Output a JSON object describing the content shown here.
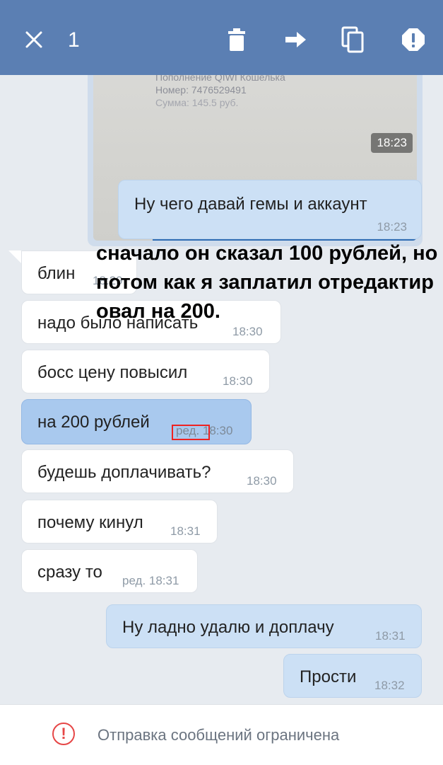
{
  "header": {
    "selected_count": "1",
    "icons": [
      "close-icon",
      "delete-icon",
      "forward-icon",
      "copy-icon",
      "report-icon"
    ],
    "bg_color": "#5b7fb3"
  },
  "photo": {
    "receipt_lines": [
      "Пополнение QIWI Кошелька",
      "Номер: 7476529491",
      "Сумма: 145.5 руб."
    ],
    "time": "18:23"
  },
  "messages": [
    {
      "dir": "out",
      "text": "Ну чего давай гемы и аккаунт",
      "time": "18:23"
    },
    {
      "dir": "in",
      "text": "блин",
      "time": "18:29"
    },
    {
      "dir": "in",
      "text": "надо было написать",
      "time": "18:30"
    },
    {
      "dir": "in",
      "text": "босс цену повысил",
      "time": "18:30"
    },
    {
      "dir": "in",
      "text": "на 200 рублей",
      "time": "ред. 18:30",
      "selected": true
    },
    {
      "dir": "in",
      "text": "будешь доплачивать?",
      "time": "18:30"
    },
    {
      "dir": "in",
      "text": "почему кинул",
      "time": "18:31"
    },
    {
      "dir": "in",
      "text": "сразу то",
      "time": "ред. 18:31"
    },
    {
      "dir": "out",
      "text": "Ну ладно удалю и доплачу",
      "time": "18:31"
    },
    {
      "dir": "out",
      "text": "Прости",
      "time": "18:32"
    }
  ],
  "annotation": {
    "text": "сначало он сказал 100 рублей, но потом как я заплатил отредактировал на 200."
  },
  "footer": {
    "notice": "Отправка сообщений ограничена",
    "warn_color": "#e64646"
  }
}
